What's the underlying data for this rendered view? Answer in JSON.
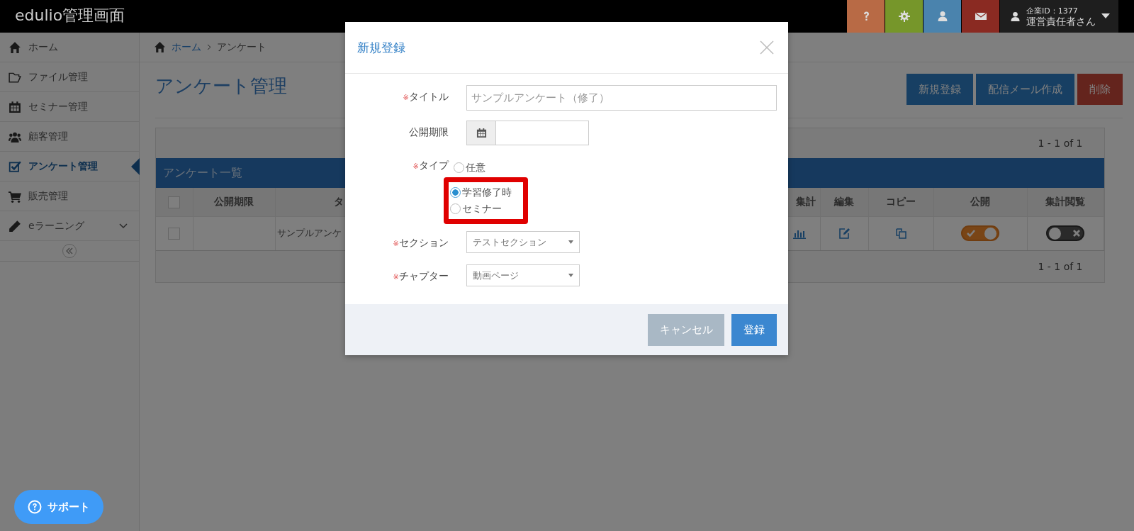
{
  "app": {
    "title": "edulio管理画面"
  },
  "header": {
    "icon_buttons": [
      {
        "kind": "help",
        "color": "#b86a45"
      },
      {
        "kind": "settings",
        "color": "#76962a"
      },
      {
        "kind": "user",
        "color": "#4a83ad"
      },
      {
        "kind": "mail",
        "color": "#8a2a22"
      }
    ],
    "user": {
      "company": "企業ID：1377",
      "name": "運営責任者さん"
    }
  },
  "sidebar": {
    "items": [
      {
        "kind": "home",
        "label": "ホーム",
        "selected": false
      },
      {
        "kind": "folder",
        "label": "ファイル管理",
        "selected": false
      },
      {
        "kind": "calendar",
        "label": "セミナー管理",
        "selected": false
      },
      {
        "kind": "users",
        "label": "顧客管理",
        "selected": false
      },
      {
        "kind": "check",
        "label": "アンケート管理",
        "selected": true
      },
      {
        "kind": "cart",
        "label": "販売管理",
        "selected": false
      },
      {
        "kind": "pencil",
        "label": "eラーニング",
        "selected": false,
        "expanded": false
      }
    ]
  },
  "breadcrumb": [
    "ホーム",
    "アンケート"
  ],
  "page": {
    "title": "アンケート管理",
    "buttons": [
      {
        "kind": "primary",
        "label": "新規登録"
      },
      {
        "kind": "primary",
        "label": "配信メール作成"
      },
      {
        "kind": "danger",
        "label": "削除"
      }
    ]
  },
  "table": {
    "pagination_top": "1 - 1 of 1",
    "caption": "アンケート一覧",
    "columns": [
      "公開期限",
      "タ",
      "集計",
      "編集",
      "コピー",
      "公開",
      "集計閲覧"
    ],
    "rows": [
      {
        "checked": false,
        "period": "",
        "title": "サンプルアンケ",
        "published": true,
        "view_results": false
      }
    ],
    "header_checked": false,
    "pagination_bottom": "1 - 1 of 1"
  },
  "support_button": {
    "label": "サポート"
  },
  "modal": {
    "title": "新規登録",
    "fields": [
      {
        "kind": "text",
        "label": "タイトル",
        "required_mark": "※",
        "placeholder": "サンプルアンケート（修了）"
      },
      {
        "kind": "date",
        "label": "公開期限"
      },
      {
        "kind": "radio",
        "label": "タイプ",
        "required_mark": "※",
        "options": [
          {
            "label": "任意",
            "selected": false,
            "highlighted": false
          },
          {
            "label": "学習修了時",
            "selected": true,
            "highlighted": true
          },
          {
            "label": "セミナー",
            "selected": false,
            "highlighted": true
          }
        ]
      },
      {
        "kind": "select",
        "label": "セクション",
        "required_mark": "※",
        "value": "テストセクション"
      },
      {
        "kind": "select",
        "label": "チャプター",
        "required_mark": "※",
        "value": "動画ページ"
      }
    ],
    "buttons": [
      {
        "kind": "cancel",
        "label": "キャンセル"
      },
      {
        "kind": "submit",
        "label": "登録"
      }
    ]
  }
}
